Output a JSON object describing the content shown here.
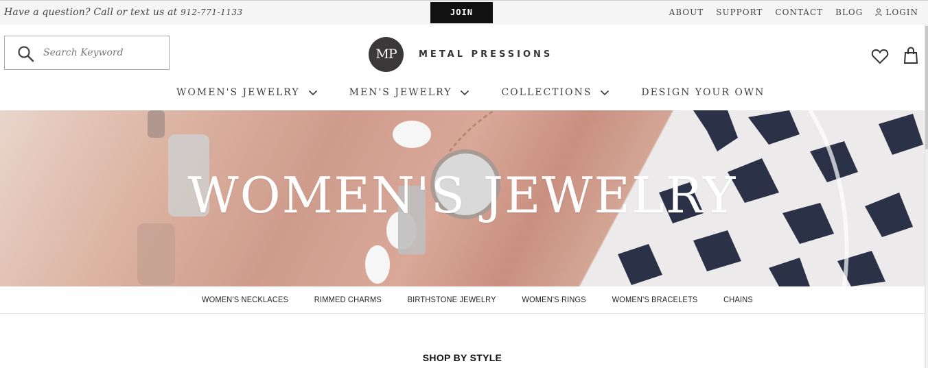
{
  "topbar": {
    "question": "Have a question? Call or text us at",
    "phone": "912-771-1133",
    "join_label": "JOIN",
    "links": [
      "ABOUT",
      "SUPPORT",
      "CONTACT",
      "BLOG",
      "LOGIN"
    ]
  },
  "header": {
    "search_placeholder": "Search Keyword",
    "logo_badge": "MP",
    "logo_text": "METAL PRESSIONS"
  },
  "nav": {
    "items": [
      "WOMEN'S JEWELRY",
      "MEN'S JEWELRY",
      "COLLECTIONS",
      "DESIGN YOUR OWN"
    ]
  },
  "hero": {
    "title": "WOMEN'S JEWELRY"
  },
  "subnav": {
    "items": [
      "WOMEN'S NECKLACES",
      "RIMMED CHARMS",
      "BIRTHSTONE JEWELRY",
      "WOMEN'S RINGS",
      "WOMEN'S BRACELETS",
      "CHAINS"
    ]
  },
  "section": {
    "shop_by_style": "SHOP BY STYLE"
  },
  "colors": {
    "join_bg": "#111111",
    "logo_badge_bg": "#3a3839",
    "hero_skin": "#d3a595",
    "pattern_navy": "#2b3147"
  },
  "icons": [
    "search-icon",
    "user-icon",
    "heart-icon",
    "bag-icon",
    "chevron-down-icon"
  ]
}
